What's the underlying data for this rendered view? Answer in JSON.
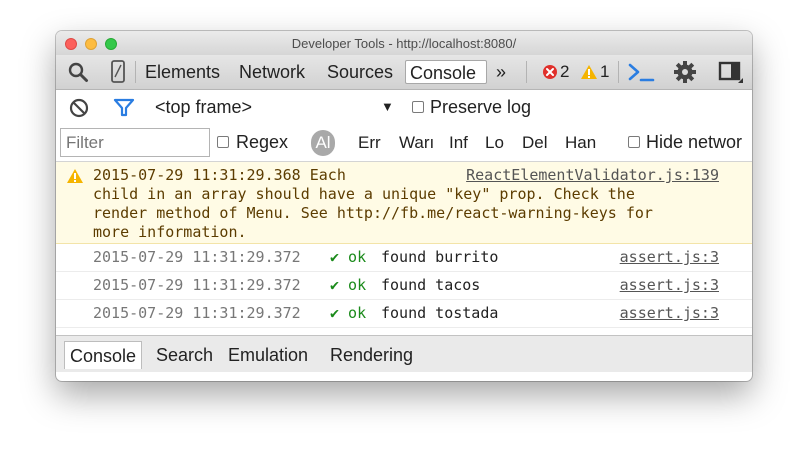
{
  "window": {
    "title": "Developer Tools - http://localhost:8080/"
  },
  "toolbar": {
    "tabs": [
      "Elements",
      "Network",
      "Sources",
      "Console"
    ],
    "active_tab": "Console",
    "more_label": "»",
    "errors": "2",
    "warnings": "1",
    "icons": [
      "search-icon",
      "device-icon",
      "more-tabs-icon",
      "error-icon",
      "warning-icon",
      "drawer-console-icon",
      "gear-icon",
      "dock-icon"
    ],
    "colors": {
      "error": "#e0302b",
      "warning": "#f5b400",
      "console_prompt": "#2a7de1"
    }
  },
  "filter_bar": {
    "frame": "<top frame>",
    "frame_arrow": "▼",
    "preserve_log": "Preserve log"
  },
  "level_bar": {
    "filter_placeholder": "Filter",
    "regex": "Regex",
    "pill": "Al",
    "levels": [
      "Err",
      "Warı",
      "Inf",
      "Lo",
      "Del",
      "Han"
    ],
    "hide_network": "Hide networ"
  },
  "messages": {
    "warning": {
      "lines": [
        "2015-07-29 11:31:29.368 Each",
        "child in an array should have a unique \"key\" prop. Check the",
        "render method of Menu. See http://fb.me/react-warning-keys for",
        "more information."
      ],
      "source": "ReactElementValidator.js:139"
    },
    "logs": [
      {
        "time": "2015-07-29 11:31:29.372",
        "check": "✔ ok",
        "text": "found burrito",
        "source": "assert.js:3"
      },
      {
        "time": "2015-07-29 11:31:29.372",
        "check": "✔ ok",
        "text": "found tacos",
        "source": "assert.js:3"
      },
      {
        "time": "2015-07-29 11:31:29.372",
        "check": "✔ ok",
        "text": "found tostada",
        "source": "assert.js:3"
      }
    ]
  },
  "drawer": {
    "tabs": [
      "Console",
      "Search",
      "Emulation",
      "Rendering"
    ],
    "active_tab": "Console"
  }
}
